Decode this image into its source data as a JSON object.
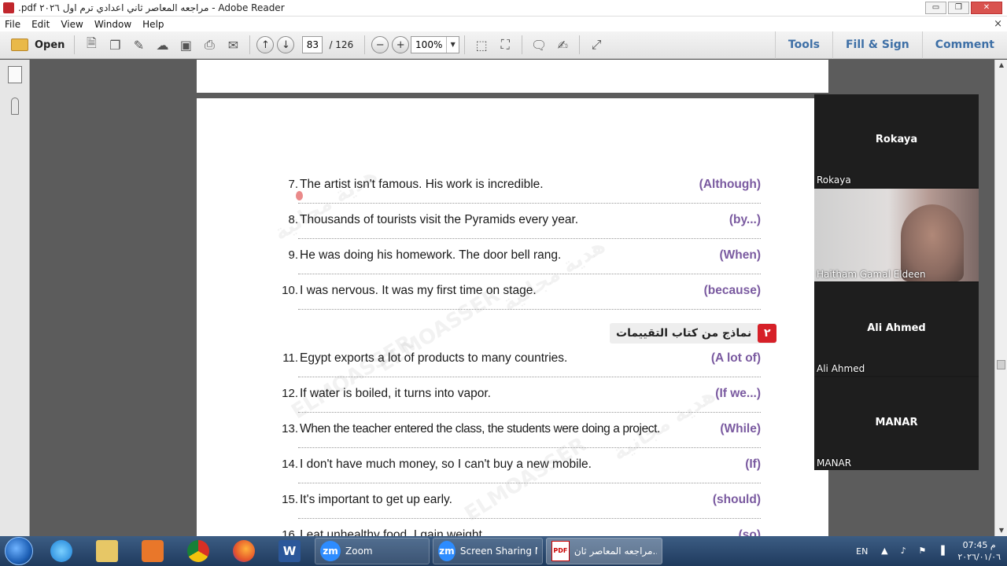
{
  "window": {
    "title": ".pdf مراجعه المعاصر ثاني اعدادي ترم اول ٢٠٢٦ - Adobe Reader",
    "min": "▭",
    "max": "❐",
    "close": "✕"
  },
  "menu": {
    "items": [
      "File",
      "Edit",
      "View",
      "Window",
      "Help"
    ],
    "close": "×"
  },
  "toolbar": {
    "open_label": "Open",
    "page_current": "83",
    "page_total": "/ 126",
    "zoom": "100%",
    "zoom_arrow": "▼",
    "prev_glyph": "↑",
    "next_glyph": "↓",
    "zoom_out_glyph": "−",
    "zoom_in_glyph": "+",
    "tools": "Tools",
    "fill_sign": "Fill & Sign",
    "comment": "Comment"
  },
  "document": {
    "exercises": [
      {
        "num": "7.",
        "sentence": "The artist isn't famous. His work is incredible.",
        "hint": "(Although)"
      },
      {
        "num": "8.",
        "sentence": "Thousands of tourists visit the Pyramids every year.",
        "hint": "(by...)"
      },
      {
        "num": "9.",
        "sentence": "He was doing his homework. The door bell rang.",
        "hint": "(When)"
      },
      {
        "num": "10.",
        "sentence": "I was nervous. It was my first time on stage.",
        "hint": "(because)"
      },
      {
        "num": "11.",
        "sentence": "Egypt exports a lot of products to many countries.",
        "hint": "(A lot of)"
      },
      {
        "num": "12.",
        "sentence": "If water is boiled, it turns into vapor.",
        "hint": "(If we...)"
      },
      {
        "num": "13.",
        "sentence": "When the teacher entered the class, the students were doing a project.",
        "hint": "(While)"
      },
      {
        "num": "14.",
        "sentence": "I don't have much money, so I can't buy a new mobile.",
        "hint": "(If)"
      },
      {
        "num": "15.",
        "sentence": "It's important to get up early.",
        "hint": "(should)"
      },
      {
        "num": "16.",
        "sentence": "I eat unhealthy food. I gain weight.",
        "hint": "(so)"
      }
    ],
    "section": {
      "badge": "٢",
      "title": "نماذج من كتاب التقييمات"
    },
    "watermarks": [
      "هدية مجانية",
      "ELMOASSER",
      "هدية مجانية",
      "ELMOASSER",
      "هدية مجانية",
      "ELMOASSER"
    ]
  },
  "participants": [
    {
      "center": "Rokaya",
      "label": "Rokaya",
      "video": false
    },
    {
      "center": "",
      "label": "Haitham Gamal Eldeen",
      "video": true
    },
    {
      "center": "Ali Ahmed",
      "label": "Ali Ahmed",
      "video": false
    },
    {
      "center": "MANAR",
      "label": "MANAR",
      "video": false
    }
  ],
  "taskbar": {
    "word_glyph": "W",
    "tasks": [
      {
        "icon": "zm",
        "label": "Zoom"
      },
      {
        "icon": "zm",
        "label": "Screen Sharing M..."
      },
      {
        "icon": "PDF",
        "label": "مراجعه المعاصر ثان..."
      }
    ],
    "lang": "EN",
    "time": "07:45 م",
    "date": "٢٠٢٦/٠١/٠٦"
  },
  "scroll": {
    "up": "▲",
    "down": "▼"
  }
}
